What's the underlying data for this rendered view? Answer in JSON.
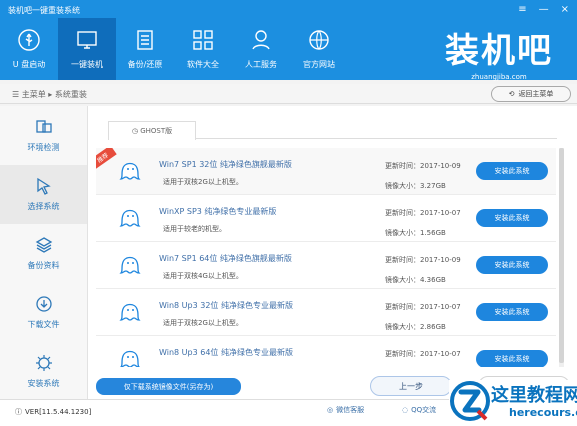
{
  "window": {
    "title": "装机吧一键重装系统",
    "controls": [
      "≡",
      "—",
      "×"
    ]
  },
  "brand": {
    "title": "装机吧",
    "domain": "zhuangjiba.com"
  },
  "nav": [
    {
      "label": "U 盘启动",
      "icon": "usb-icon",
      "active": false
    },
    {
      "label": "一键装机",
      "icon": "monitor-icon",
      "active": true
    },
    {
      "label": "备份/还原",
      "icon": "backup-icon",
      "active": false
    },
    {
      "label": "软件大全",
      "icon": "apps-icon",
      "active": false
    },
    {
      "label": "人工服务",
      "icon": "service-icon",
      "active": false
    },
    {
      "label": "官方网站",
      "icon": "website-icon",
      "active": false
    }
  ],
  "breadcrumb": {
    "root": "主菜单",
    "current": "系统重装"
  },
  "back_button": {
    "label": "返回主菜单"
  },
  "sidebar": [
    {
      "label": "环境检测",
      "icon": "detect-icon",
      "active": false
    },
    {
      "label": "选择系统",
      "icon": "select-icon",
      "active": true
    },
    {
      "label": "备份资料",
      "icon": "backup-data-icon",
      "active": false
    },
    {
      "label": "下载文件",
      "icon": "download-icon",
      "active": false
    },
    {
      "label": "安装系统",
      "icon": "install-icon",
      "active": false
    }
  ],
  "tabs": [
    {
      "label": "GHOST版"
    }
  ],
  "systems": [
    {
      "name": "Win7 SP1 32位 纯净绿色旗舰最新版",
      "desc": "适用于双核2G以上机型。",
      "updated": "更新时间：2017-10-09",
      "size": "镜像大小：3.27GB",
      "button": "安装此系统",
      "badge": "推荐"
    },
    {
      "name": "WinXP SP3 纯净绿色专业最新版",
      "desc": "适用于较老的机型。",
      "updated": "更新时间：2017-10-07",
      "size": "镜像大小：1.56GB",
      "button": "安装此系统"
    },
    {
      "name": "Win7 SP1 64位 纯净绿色旗舰最新版",
      "desc": "适用于双核4G以上机型。",
      "updated": "更新时间：2017-10-09",
      "size": "镜像大小：4.36GB",
      "button": "安装此系统"
    },
    {
      "name": "Win8 Up3 32位 纯净绿色专业最新版",
      "desc": "适用于双核2G以上机型。",
      "updated": "更新时间：2017-10-07",
      "size": "镜像大小：2.86GB",
      "button": "安装此系统"
    },
    {
      "name": "Win8 Up3 64位 纯净绿色专业最新版",
      "desc": "",
      "updated": "更新时间：2017-10-07",
      "size": "",
      "button": "安装此系统"
    }
  ],
  "footer": {
    "download_button": "仅下载系统镜像文件(另存为)",
    "prev_button": "上一步",
    "version": "VER[11.5.44.1230]",
    "wechat": "微信客服",
    "qq": "QQ交流"
  },
  "watermark": {
    "title": "这里教程网",
    "url": "herecours.com"
  }
}
